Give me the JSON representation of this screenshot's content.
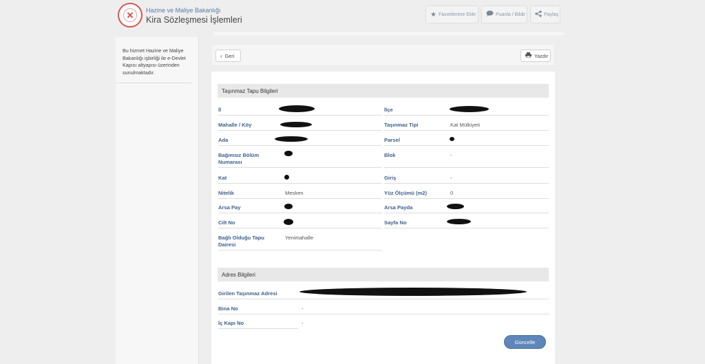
{
  "header": {
    "ministry": "Hazine ve Maliye Bakanlığı",
    "service_title": "Kira Sözleşmesi İşlemleri",
    "buttons": {
      "favorite": "Favorilerime Ekle",
      "rate": "Puanla / Bildir",
      "share": "Paylaş"
    }
  },
  "sidebar": {
    "info": "Bu hizmet Hazine ve Maliye Bakanlığı işbirliği ile e-Devlet Kapısı altyapısı üzerinden sunulmaktadır."
  },
  "toolbar": {
    "back_label": "Geri",
    "print_label": "Yazdır"
  },
  "tapu": {
    "title": "Taşınmaz Tapu Bilgileri",
    "il_label": "İl",
    "ilce_label": "İlçe",
    "mahalle_label": "Mahalle / Köy",
    "tasinmaz_tipi_label": "Taşınmaz Tipi",
    "tasinmaz_tipi_value": "Kat Mülkiyeti",
    "ada_label": "Ada",
    "parsel_label": "Parsel",
    "bagimsiz_label_1": "Bağımsız Bölüm",
    "bagimsiz_label_2": "Numarası",
    "blok_label": "Blok",
    "blok_value": "-",
    "kat_label": "Kat",
    "giris_label": "Giriş",
    "giris_value": "-",
    "nitelik_label": "Nitelik",
    "nitelik_value": "Mesken",
    "yuz_olcumu_label": "Yüz Ölçümü (m2)",
    "yuz_olcumu_value": "0",
    "arsa_pay_label": "Arsa Pay",
    "arsa_payda_label": "Arsa Payda",
    "cilt_label": "Cilt No",
    "sayfa_label": "Sayfa No",
    "tapu_dairesi_label_1": "Bağlı Olduğu Tapu",
    "tapu_dairesi_label_2": "Dairesi",
    "tapu_dairesi_value": "Yenimahalle"
  },
  "adres": {
    "title": "Adres Bilgileri",
    "girilen_label": "Girilen Taşınmaz Adresi",
    "bina_label": "Bina No",
    "bina_value": "-",
    "ic_kapi_label": "İç Kapı No",
    "ic_kapi_value": "-"
  },
  "actions": {
    "update_label": "Güncelle"
  },
  "colors": {
    "label_blue": "#3d5f8c",
    "primary_button": "#5e86b8",
    "logo_red": "#d9534f"
  }
}
